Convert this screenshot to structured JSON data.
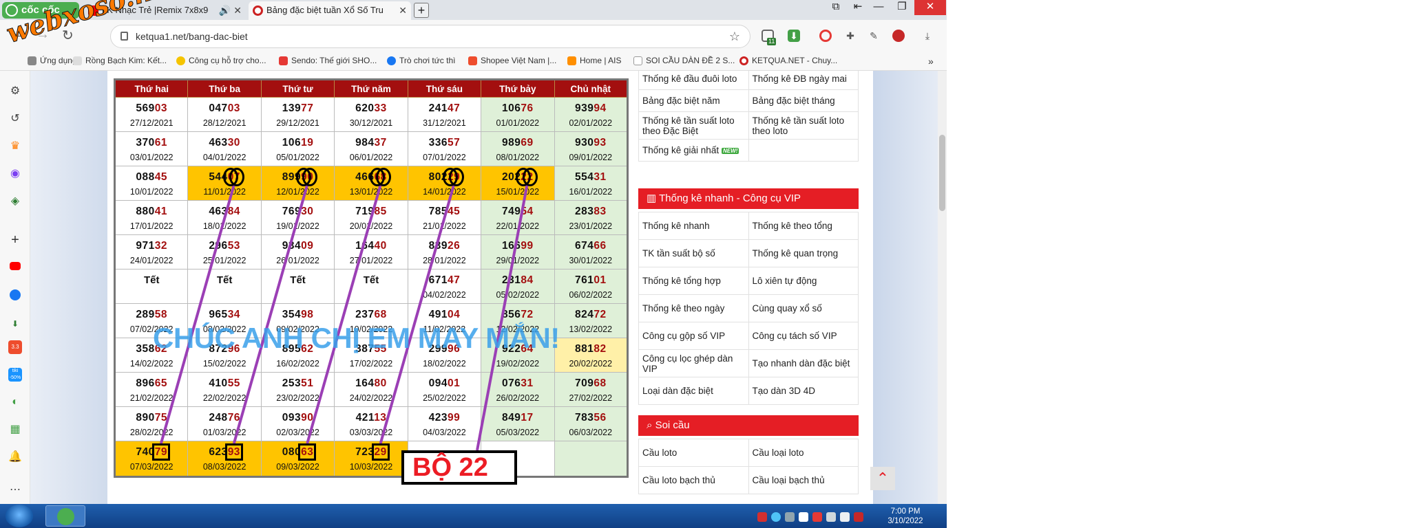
{
  "browser": {
    "logo_label": "cốc cốc",
    "tabs": [
      {
        "label": "LK Nhạc Trẻ |Remix 7x8x9",
        "active": false
      },
      {
        "label": "Bảng đặc biệt tuần Xổ Số Tru",
        "active": true
      }
    ],
    "url": "ketqua1.net/bang-dac-biet",
    "extension_badge": "11",
    "bookmarks": [
      {
        "label": "Ứng dụng"
      },
      {
        "label": "Rồng Bạch Kim: Kết..."
      },
      {
        "label": "Công cụ hỗ trợ cho..."
      },
      {
        "label": "Sendo: Thế giới SHO..."
      },
      {
        "label": "Trò chơi tức thì"
      },
      {
        "label": "Shopee Việt Nam |..."
      },
      {
        "label": "Home | AIS"
      },
      {
        "label": "SOI CẦU DÀN ĐỀ 2 S..."
      },
      {
        "label": "KETQUA.NET - Chuy..."
      }
    ],
    "sidebar_badges": {
      "shopee": "3.3",
      "tiki": "tiki -50%"
    }
  },
  "watermark": "webxoso.net",
  "table": {
    "headers": [
      "Thứ hai",
      "Thứ ba",
      "Thứ tư",
      "Thứ năm",
      "Thứ sáu",
      "Thứ bảy",
      "Chủ nhật"
    ],
    "rows": [
      [
        {
          "n": "569",
          "h": "03",
          "d": "27/12/2021"
        },
        {
          "n": "047",
          "h": "03",
          "d": "28/12/2021"
        },
        {
          "n": "139",
          "h": "77",
          "d": "29/12/2021"
        },
        {
          "n": "620",
          "h": "33",
          "d": "30/12/2021"
        },
        {
          "n": "241",
          "h": "47",
          "d": "31/12/2021"
        },
        {
          "n": "106",
          "h": "76",
          "d": "01/01/2022",
          "c": "g"
        },
        {
          "n": "939",
          "h": "94",
          "d": "02/01/2022",
          "c": "g"
        }
      ],
      [
        {
          "n": "370",
          "h": "61",
          "d": "03/01/2022"
        },
        {
          "n": "463",
          "h": "30",
          "d": "04/01/2022"
        },
        {
          "n": "106",
          "h": "19",
          "d": "05/01/2022"
        },
        {
          "n": "984",
          "h": "37",
          "d": "06/01/2022"
        },
        {
          "n": "336",
          "h": "57",
          "d": "07/01/2022"
        },
        {
          "n": "989",
          "h": "69",
          "d": "08/01/2022",
          "c": "g"
        },
        {
          "n": "930",
          "h": "93",
          "d": "09/01/2022",
          "c": "g"
        }
      ],
      [
        {
          "n": "088",
          "h": "45",
          "d": "10/01/2022"
        },
        {
          "n": "544",
          "h": "07",
          "d": "11/01/2022",
          "c": "o"
        },
        {
          "n": "899",
          "h": "90",
          "d": "12/01/2022",
          "c": "o"
        },
        {
          "n": "466",
          "h": "68",
          "d": "13/01/2022",
          "c": "o"
        },
        {
          "n": "802",
          "h": "29",
          "d": "14/01/2022",
          "c": "o"
        },
        {
          "n": "202",
          "h": "22",
          "d": "15/01/2022",
          "c": "o"
        },
        {
          "n": "554",
          "h": "31",
          "d": "16/01/2022",
          "c": "g"
        }
      ],
      [
        {
          "n": "880",
          "h": "41",
          "d": "17/01/2022"
        },
        {
          "n": "463",
          "h": "84",
          "d": "18/01/2022"
        },
        {
          "n": "769",
          "h": "30",
          "d": "19/01/2022"
        },
        {
          "n": "719",
          "h": "85",
          "d": "20/01/2022"
        },
        {
          "n": "785",
          "h": "45",
          "d": "21/01/2022"
        },
        {
          "n": "749",
          "h": "54",
          "d": "22/01/2022",
          "c": "g"
        },
        {
          "n": "283",
          "h": "83",
          "d": "23/01/2022",
          "c": "g"
        }
      ],
      [
        {
          "n": "971",
          "h": "32",
          "d": "24/01/2022"
        },
        {
          "n": "296",
          "h": "53",
          "d": "25/01/2022"
        },
        {
          "n": "934",
          "h": "09",
          "d": "26/01/2022"
        },
        {
          "n": "164",
          "h": "40",
          "d": "27/01/2022"
        },
        {
          "n": "839",
          "h": "26",
          "d": "28/01/2022"
        },
        {
          "n": "166",
          "h": "99",
          "d": "29/01/2022",
          "c": "g"
        },
        {
          "n": "674",
          "h": "66",
          "d": "30/01/2022",
          "c": "g"
        }
      ],
      [
        {
          "t": "Tết"
        },
        {
          "t": "Tết"
        },
        {
          "t": "Tết"
        },
        {
          "t": "Tết"
        },
        {
          "n": "671",
          "h": "47",
          "d": "04/02/2022"
        },
        {
          "n": "231",
          "h": "84",
          "d": "05/02/2022",
          "c": "g"
        },
        {
          "n": "761",
          "h": "01",
          "d": "06/02/2022",
          "c": "g"
        }
      ],
      [
        {
          "n": "289",
          "h": "58",
          "d": "07/02/2022"
        },
        {
          "n": "965",
          "h": "34",
          "d": "08/02/2022"
        },
        {
          "n": "354",
          "h": "98",
          "d": "09/02/2022"
        },
        {
          "n": "237",
          "h": "68",
          "d": "10/02/2022"
        },
        {
          "n": "491",
          "h": "04",
          "d": "11/02/2022"
        },
        {
          "n": "856",
          "h": "72",
          "d": "12/02/2022",
          "c": "g"
        },
        {
          "n": "824",
          "h": "72",
          "d": "13/02/2022",
          "c": "g"
        }
      ],
      [
        {
          "n": "358",
          "h": "62",
          "d": "14/02/2022"
        },
        {
          "n": "872",
          "h": "96",
          "d": "15/02/2022"
        },
        {
          "n": "895",
          "h": "62",
          "d": "16/02/2022"
        },
        {
          "n": "387",
          "h": "55",
          "d": "17/02/2022"
        },
        {
          "n": "299",
          "h": "96",
          "d": "18/02/2022"
        },
        {
          "n": "922",
          "h": "64",
          "d": "19/02/2022",
          "c": "g"
        },
        {
          "n": "881",
          "h": "82",
          "d": "20/02/2022",
          "c": "y"
        }
      ],
      [
        {
          "n": "896",
          "h": "65",
          "d": "21/02/2022"
        },
        {
          "n": "410",
          "h": "55",
          "d": "22/02/2022"
        },
        {
          "n": "253",
          "h": "51",
          "d": "23/02/2022"
        },
        {
          "n": "164",
          "h": "80",
          "d": "24/02/2022"
        },
        {
          "n": "094",
          "h": "01",
          "d": "25/02/2022"
        },
        {
          "n": "076",
          "h": "31",
          "d": "26/02/2022",
          "c": "g"
        },
        {
          "n": "709",
          "h": "68",
          "d": "27/02/2022",
          "c": "g"
        }
      ],
      [
        {
          "n": "890",
          "h": "75",
          "d": "28/02/2022"
        },
        {
          "n": "248",
          "h": "76",
          "d": "01/03/2022"
        },
        {
          "n": "093",
          "h": "90",
          "d": "02/03/2022"
        },
        {
          "n": "421",
          "h": "13",
          "d": "03/03/2022"
        },
        {
          "n": "423",
          "h": "99",
          "d": "04/03/2022"
        },
        {
          "n": "849",
          "h": "17",
          "d": "05/03/2022",
          "c": "g"
        },
        {
          "n": "783",
          "h": "56",
          "d": "06/03/2022",
          "c": "g"
        }
      ],
      [
        {
          "n": "740",
          "h": "79",
          "d": "07/03/2022",
          "c": "o"
        },
        {
          "n": "623",
          "h": "93",
          "d": "08/03/2022",
          "c": "o"
        },
        {
          "n": "080",
          "h": "63",
          "d": "09/03/2022",
          "c": "o"
        },
        {
          "n": "723",
          "h": "29",
          "d": "10/03/2022",
          "c": "o"
        },
        {
          "c": "w"
        },
        {
          "c": "w"
        },
        {
          "c": "g"
        }
      ]
    ]
  },
  "overlay": {
    "greeting": "CHÚC ANH CHỊ EM MAY MẮN!",
    "bo_label": "BỘ 22"
  },
  "right_panel": {
    "top_links": [
      [
        "Thống kê đầu đuôi loto",
        "Thống kê ĐB ngày mai"
      ],
      [
        "Bảng đặc biệt năm",
        "Bảng đặc biệt tháng"
      ],
      [
        "Thống kê tần suất loto theo Đặc Biệt",
        "Thống kê tần suất loto theo loto"
      ],
      [
        "Thống kê giải nhất",
        ""
      ]
    ],
    "new_badge": "NEW!",
    "section_vip": "Thống kê nhanh - Công cụ VIP",
    "vip_links": [
      [
        "Thống kê nhanh",
        "Thống kê theo tổng"
      ],
      [
        "TK tần suất bộ số",
        "Thống kê quan trọng"
      ],
      [
        "Thống kê tổng hợp",
        "Lô xiên tự động"
      ],
      [
        "Thống kê theo ngày",
        "Cùng quay xổ số"
      ],
      [
        "Công cụ gộp số VIP",
        "Công cụ tách số VIP"
      ],
      [
        "Công cụ lọc ghép dàn VIP",
        "Tạo nhanh dàn đặc biệt"
      ],
      [
        "Loại dàn đặc biệt",
        "Tạo dàn 3D 4D"
      ]
    ],
    "section_soicau": "Soi cầu",
    "soicau_links": [
      [
        "Cầu loto",
        "Cầu loại loto"
      ],
      [
        "Cầu loto bạch thủ",
        "Cầu loại bạch thủ"
      ]
    ]
  },
  "taskbar": {
    "time": "7:00 PM",
    "date": "3/10/2022"
  }
}
